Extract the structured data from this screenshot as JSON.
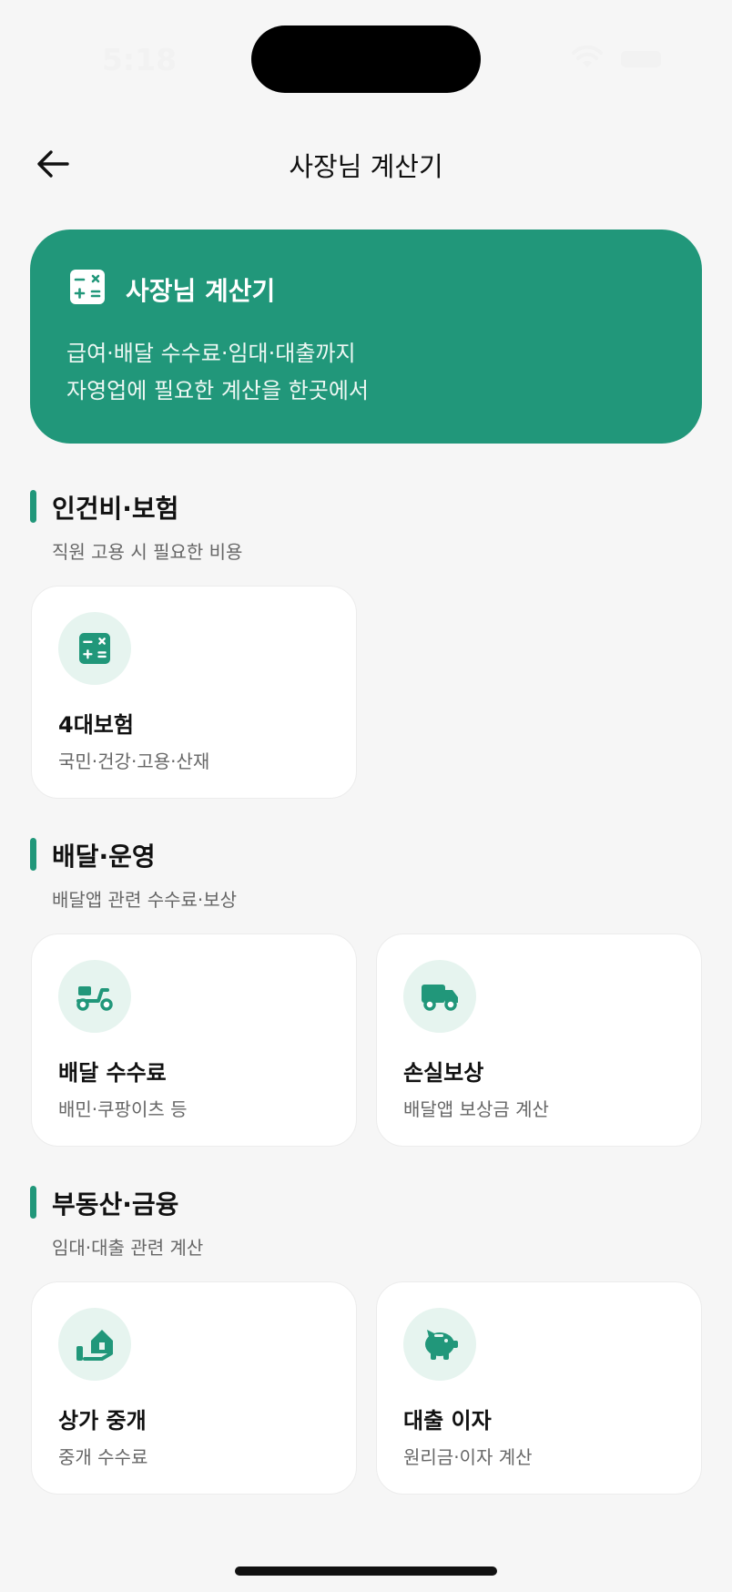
{
  "status_bar": {
    "time": "5:18"
  },
  "nav": {
    "title": "사장님 계산기"
  },
  "hero": {
    "title": "사장님 계산기",
    "line1": "급여·배달 수수료·임대·대출까지",
    "line2": "자영업에 필요한 계산을 한곳에서",
    "color": "#21977a"
  },
  "sections": [
    {
      "title": "인건비·보험",
      "subtitle": "직원 고용 시 필요한 비용",
      "cards": [
        {
          "title": "4대보험",
          "subtitle": "국민·건강·고용·산재",
          "icon": "calculator-icon"
        }
      ]
    },
    {
      "title": "배달·운영",
      "subtitle": "배달앱 관련 수수료·보상",
      "cards": [
        {
          "title": "배달 수수료",
          "subtitle": "배민·쿠팡이츠 등",
          "icon": "scooter-icon"
        },
        {
          "title": "손실보상",
          "subtitle": "배달앱 보상금 계산",
          "icon": "truck-icon"
        }
      ]
    },
    {
      "title": "부동산·금융",
      "subtitle": "임대·대출 관련 계산",
      "cards": [
        {
          "title": "상가 중개",
          "subtitle": "중개 수수료",
          "icon": "house-hand-icon"
        },
        {
          "title": "대출 이자",
          "subtitle": "원리금·이자 계산",
          "icon": "piggy-bank-icon"
        }
      ]
    }
  ],
  "accent_color": "#21977a",
  "icon_bg_color": "#e6f4ef"
}
